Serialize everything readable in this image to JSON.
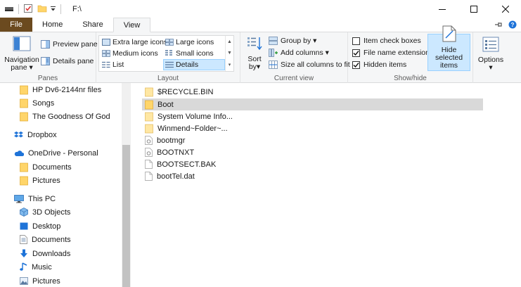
{
  "window": {
    "title": "F:\\"
  },
  "tabs": [
    {
      "label": "File"
    },
    {
      "label": "Home"
    },
    {
      "label": "Share"
    },
    {
      "label": "View"
    }
  ],
  "ribbon": {
    "panes": {
      "label": "Panes",
      "navigation_pane": "Navigation\npane",
      "navigation_pane_l1": "Navigation",
      "navigation_pane_l2": "pane",
      "preview_pane": "Preview pane",
      "details_pane": "Details pane"
    },
    "layout": {
      "label": "Layout",
      "items": [
        {
          "label": "Extra large icons"
        },
        {
          "label": "Large icons"
        },
        {
          "label": "Medium icons"
        },
        {
          "label": "Small icons"
        },
        {
          "label": "List"
        },
        {
          "label": "Details"
        }
      ],
      "selected": "Details"
    },
    "current_view": {
      "label": "Current view",
      "sort_by_l1": "Sort",
      "sort_by_l2": "by",
      "group_by": "Group by",
      "add_columns": "Add columns",
      "size_all_columns": "Size all columns to fit"
    },
    "show_hide": {
      "label": "Show/hide",
      "item_check_boxes": {
        "label": "Item check boxes",
        "checked": false
      },
      "file_name_extensions": {
        "label": "File name extensions",
        "checked": true
      },
      "hidden_items": {
        "label": "Hidden items",
        "checked": true
      },
      "hide_selected_l1": "Hide selected",
      "hide_selected_l2": "items"
    },
    "options": {
      "label": "Options"
    }
  },
  "nav": {
    "items": [
      {
        "label": "HP Dv6-2144nr files",
        "icon": "folder-icon"
      },
      {
        "label": "Songs",
        "icon": "folder-icon"
      },
      {
        "label": "The Goodness Of God",
        "icon": "folder-icon"
      },
      {
        "label": "Dropbox",
        "icon": "dropbox-icon"
      },
      {
        "label": "OneDrive - Personal",
        "icon": "onedrive-icon"
      },
      {
        "label": "Documents",
        "icon": "folder-icon"
      },
      {
        "label": "Pictures",
        "icon": "folder-icon"
      },
      {
        "label": "This PC",
        "icon": "pc-icon"
      },
      {
        "label": "3D Objects",
        "icon": "3d-objects-icon"
      },
      {
        "label": "Desktop",
        "icon": "desktop-icon"
      },
      {
        "label": "Documents",
        "icon": "documents-icon"
      },
      {
        "label": "Downloads",
        "icon": "downloads-icon"
      },
      {
        "label": "Music",
        "icon": "music-icon"
      },
      {
        "label": "Pictures",
        "icon": "pictures-icon"
      }
    ]
  },
  "files": [
    {
      "name": "$RECYCLE.BIN",
      "type": "folder",
      "selected": false
    },
    {
      "name": "Boot",
      "type": "folder",
      "selected": true
    },
    {
      "name": "System Volume Info...",
      "type": "folder",
      "selected": false
    },
    {
      "name": "Winmend~Folder~...",
      "type": "folder",
      "selected": false
    },
    {
      "name": "bootmgr",
      "type": "system-file",
      "selected": false
    },
    {
      "name": "BOOTNXT",
      "type": "system-file",
      "selected": false
    },
    {
      "name": "BOOTSECT.BAK",
      "type": "file",
      "selected": false
    },
    {
      "name": "bootTel.dat",
      "type": "file",
      "selected": false
    }
  ],
  "colors": {
    "file_tab": "#6b4a1f",
    "selection": "#cce8ff",
    "folder": "#ffd56a",
    "row_selected": "#d9d9d9"
  }
}
